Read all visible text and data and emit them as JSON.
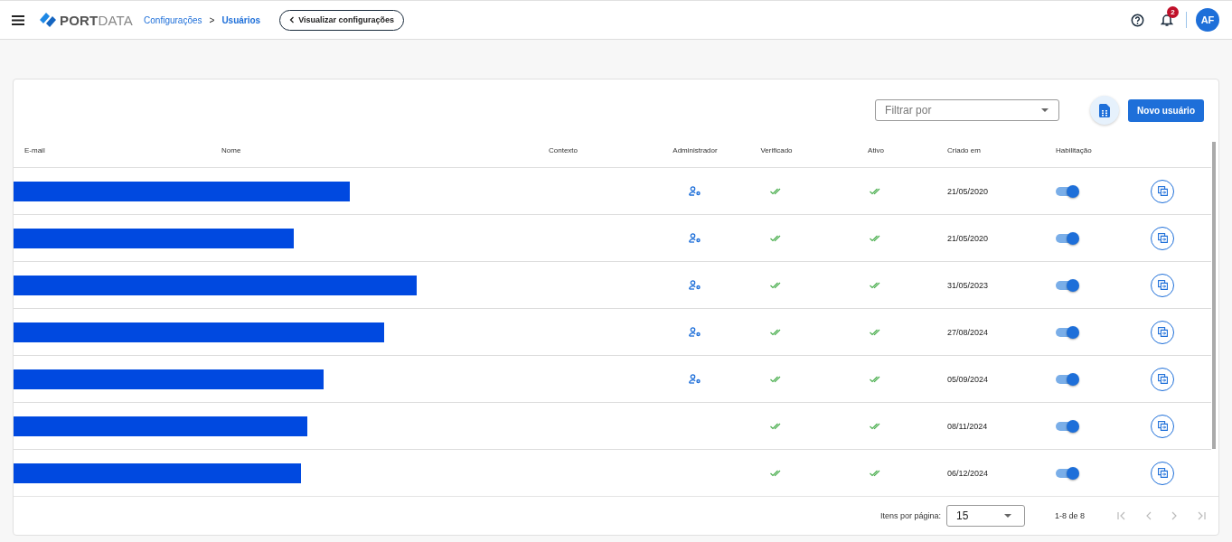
{
  "header": {
    "logo": {
      "bold": "PORT",
      "light": "DATA"
    },
    "breadcrumb": [
      {
        "label": "Configurações",
        "current": false
      },
      {
        "label": "Usuários",
        "current": true
      }
    ],
    "breadcrumb_separator": ">",
    "back_button": "Visualizar configurações",
    "notifications": "2",
    "avatar": "AF"
  },
  "toolbar": {
    "filter": {
      "placeholder": "Filtrar por"
    },
    "new_button": "Novo usuário"
  },
  "table": {
    "columns": [
      "E-mail",
      "Nome",
      "Contexto",
      "Administrador",
      "Verificado",
      "Ativo",
      "Criado em",
      "Habilitação"
    ],
    "rows": [
      {
        "admin": true,
        "verified": true,
        "active": true,
        "created": "21/05/2020",
        "enabled": true
      },
      {
        "admin": true,
        "verified": true,
        "active": true,
        "created": "21/05/2020",
        "enabled": true
      },
      {
        "admin": true,
        "verified": true,
        "active": true,
        "created": "31/05/2023",
        "enabled": true
      },
      {
        "admin": true,
        "verified": true,
        "active": true,
        "created": "27/08/2024",
        "enabled": true
      },
      {
        "admin": true,
        "verified": true,
        "active": true,
        "created": "05/09/2024",
        "enabled": true
      },
      {
        "admin": false,
        "verified": true,
        "active": true,
        "created": "08/11/2024",
        "enabled": true
      },
      {
        "admin": false,
        "verified": true,
        "active": true,
        "created": "06/12/2024",
        "enabled": true
      }
    ]
  },
  "paginator": {
    "label": "Itens por página:",
    "page_size": "15",
    "range": "1-8 de 8"
  }
}
